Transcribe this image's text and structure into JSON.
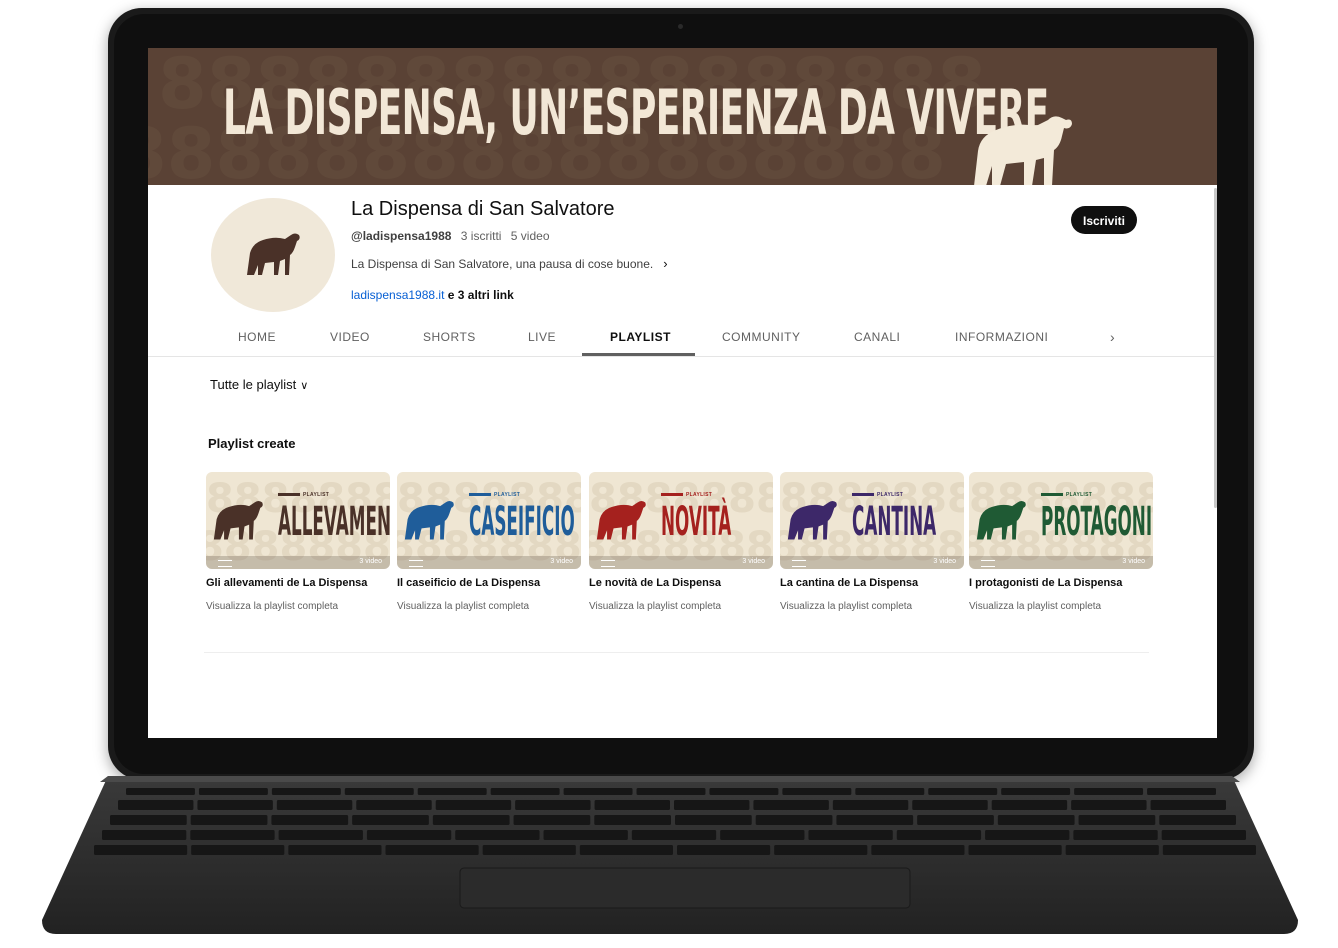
{
  "banner": {
    "title": "LA DISPENSA, UN’ESPERIENZA DA VIVERE",
    "bg_color": "#5a4235",
    "icon": "buffalo-logo"
  },
  "channel": {
    "name": "La Dispensa di San Salvatore",
    "handle": "@ladispensa1988",
    "subscribers": "3 iscritti",
    "videos": "5 video",
    "description": "La Dispensa di San Salvatore, una pausa di cose buone.",
    "link": "ladispensa1988.it",
    "more_links": "e 3 altri link",
    "subscribe_label": "Iscriviti",
    "avatar_icon": "buffalo-logo"
  },
  "tabs": [
    {
      "label": "HOME",
      "active": false
    },
    {
      "label": "VIDEO",
      "active": false
    },
    {
      "label": "SHORTS",
      "active": false
    },
    {
      "label": "LIVE",
      "active": false
    },
    {
      "label": "PLAYLIST",
      "active": true
    },
    {
      "label": "COMMUNITY",
      "active": false
    },
    {
      "label": "CANALI",
      "active": false
    },
    {
      "label": "INFORMAZIONI",
      "active": false
    }
  ],
  "filter": {
    "label": "Tutte le playlist"
  },
  "section_title": "Playlist create",
  "playlists": [
    {
      "thumb_title": "ALLEVAMENTI",
      "tag": "PLAYLIST",
      "color": "#4a3128",
      "count": "3 video",
      "title": "Gli allevamenti de La Dispensa",
      "link": "Visualizza la playlist completa"
    },
    {
      "thumb_title": "CASEIFICIO",
      "tag": "PLAYLIST",
      "color": "#1f5d9a",
      "count": "3 video",
      "title": "Il caseificio de La Dispensa",
      "link": "Visualizza la playlist completa"
    },
    {
      "thumb_title": "NOVITÀ",
      "tag": "PLAYLIST",
      "color": "#a5211e",
      "count": "3 video",
      "title": "Le novità de La Dispensa",
      "link": "Visualizza la playlist completa"
    },
    {
      "thumb_title": "CANTINA",
      "tag": "PLAYLIST",
      "color": "#3d2869",
      "count": "3 video",
      "title": "La cantina de La Dispensa",
      "link": "Visualizza la playlist completa"
    },
    {
      "thumb_title": "PROTAGONISTI",
      "tag": "PLAYLIST",
      "color": "#1f5a34",
      "count": "3 video",
      "title": "I protagonisti de La Dispensa",
      "link": "Visualizza la playlist completa"
    }
  ]
}
